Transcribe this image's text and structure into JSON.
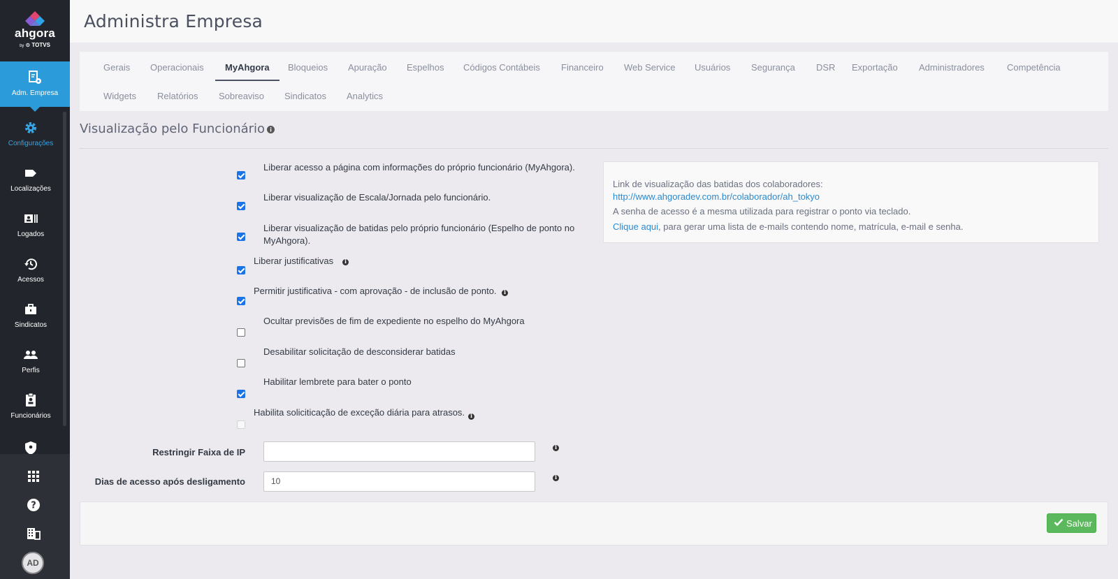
{
  "brand": {
    "name": "ahgora",
    "by": "by",
    "partner": "TOTVS"
  },
  "sidebar": {
    "items": [
      {
        "label": "Adm. Empresa",
        "icon": "company-admin-icon"
      },
      {
        "label": "Configurações",
        "icon": "gear-icon"
      },
      {
        "label": "Localizações",
        "icon": "tag-icon"
      },
      {
        "label": "Logados",
        "icon": "id-card-icon"
      },
      {
        "label": "Acessos",
        "icon": "history-icon"
      },
      {
        "label": "Sindicatos",
        "icon": "briefcase-icon"
      },
      {
        "label": "Perfis",
        "icon": "users-icon"
      },
      {
        "label": "Funcionários",
        "icon": "clipboard-user-icon"
      }
    ],
    "bottom": [
      "apps-grid-icon",
      "help-icon",
      "building-icon"
    ],
    "avatar": "AD"
  },
  "header": {
    "title": "Administra Empresa"
  },
  "tabs": {
    "row1": [
      "Gerais",
      "Operacionais",
      "MyAhgora",
      "Bloqueios",
      "Apuração",
      "Espelhos",
      "Códigos Contábeis",
      "Financeiro",
      "Web Service",
      "Usuários",
      "Segurança",
      "DSR",
      "Exportação",
      "Administradores",
      "Competência"
    ],
    "row2": [
      "Widgets",
      "Relatórios",
      "Sobreaviso",
      "Sindicatos",
      "Analytics"
    ],
    "active": "MyAhgora"
  },
  "section": {
    "title": "Visualização pelo Funcionário"
  },
  "options": [
    {
      "label": "Liberar acesso a página com informações do próprio funcionário (MyAhgora).",
      "checked": true
    },
    {
      "label": "Liberar visualização de Escala/Jornada pelo funcionário.",
      "checked": true
    },
    {
      "label": "Liberar visualização de batidas pelo próprio funcionário (Espelho de ponto no",
      "label2": "MyAhgora).",
      "checked": true
    },
    {
      "label": "Liberar justificativas",
      "checked": true,
      "info": true
    },
    {
      "label": "Permitir justificativa - com aprovação - de inclusão de ponto.",
      "checked": true,
      "info": true
    },
    {
      "label": "Ocultar previsões de fim de expediente no espelho do MyAhgora",
      "checked": false
    },
    {
      "label": "Desabilitar solicitação de desconsiderar batidas",
      "checked": false
    },
    {
      "label": "Habilitar lembrete para bater o ponto",
      "checked": true
    },
    {
      "label": "Habilita soliciticação de exceção diária para atrasos.",
      "checked": false,
      "disabled": true,
      "info": true
    }
  ],
  "info_panel": {
    "line1": "Link de visualização das batidas dos colaboradores:",
    "link": "http://www.ahgoradev.com.br/colaborador/ah_tokyo",
    "line3": "A senha de acesso é a mesma utilizada para registrar o ponto via teclado.",
    "click_here": "Clique aqui",
    "line4_rest": ", para gerar uma lista de e-mails contendo nome, matrícula, e-mail e senha."
  },
  "fields": {
    "ip_label": "Restringir Faixa de IP",
    "ip_value": "",
    "days_label": "Dias de acesso após desligamento",
    "days_value": "10"
  },
  "footer": {
    "save_label": "Salvar"
  },
  "colors": {
    "sidebar_bg": "#23252c",
    "accent": "#2c9bd9",
    "save": "#5cb85c",
    "link": "#2a8ad0"
  }
}
